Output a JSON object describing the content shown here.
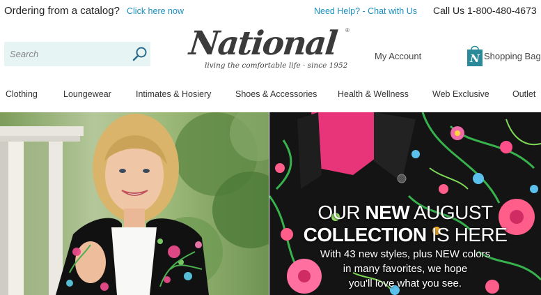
{
  "topbar": {
    "catalog_question": "Ordering from a catalog?",
    "catalog_link": "Click here now",
    "help_link": "Need Help? - Chat with Us",
    "phone": "Call Us 1-800-480-4673"
  },
  "search": {
    "placeholder": "Search",
    "icon": "magnifier-icon"
  },
  "logo": {
    "wordmark": "National",
    "registered": "®",
    "tagline": "living the comfortable life  ·  since 1952"
  },
  "account": {
    "label": "My Account"
  },
  "bag": {
    "label": "Shopping Bag",
    "badge_letter": "N",
    "icon": "shopping-bag-icon"
  },
  "nav": {
    "items": [
      "Clothing",
      "Loungewear",
      "Intimates & Hosiery",
      "Shoes & Accessories",
      "Health & Wellness",
      "Web Exclusive",
      "Outlet"
    ]
  },
  "hero": {
    "h1_pre": "OUR ",
    "h1_bold": "NEW",
    "h1_post": " AUGUST",
    "h2_bold": "COLLECTION",
    "h2_post": " IS HERE",
    "sub_1": "With 43 new styles, plus NEW colors",
    "sub_2": "in many favorites, we hope",
    "sub_3": "you'll love what you see."
  },
  "colors": {
    "link": "#1a8fc2",
    "search_bg": "#e6f4f4",
    "bag_icon": "#2a8a9a",
    "text": "#333333"
  }
}
